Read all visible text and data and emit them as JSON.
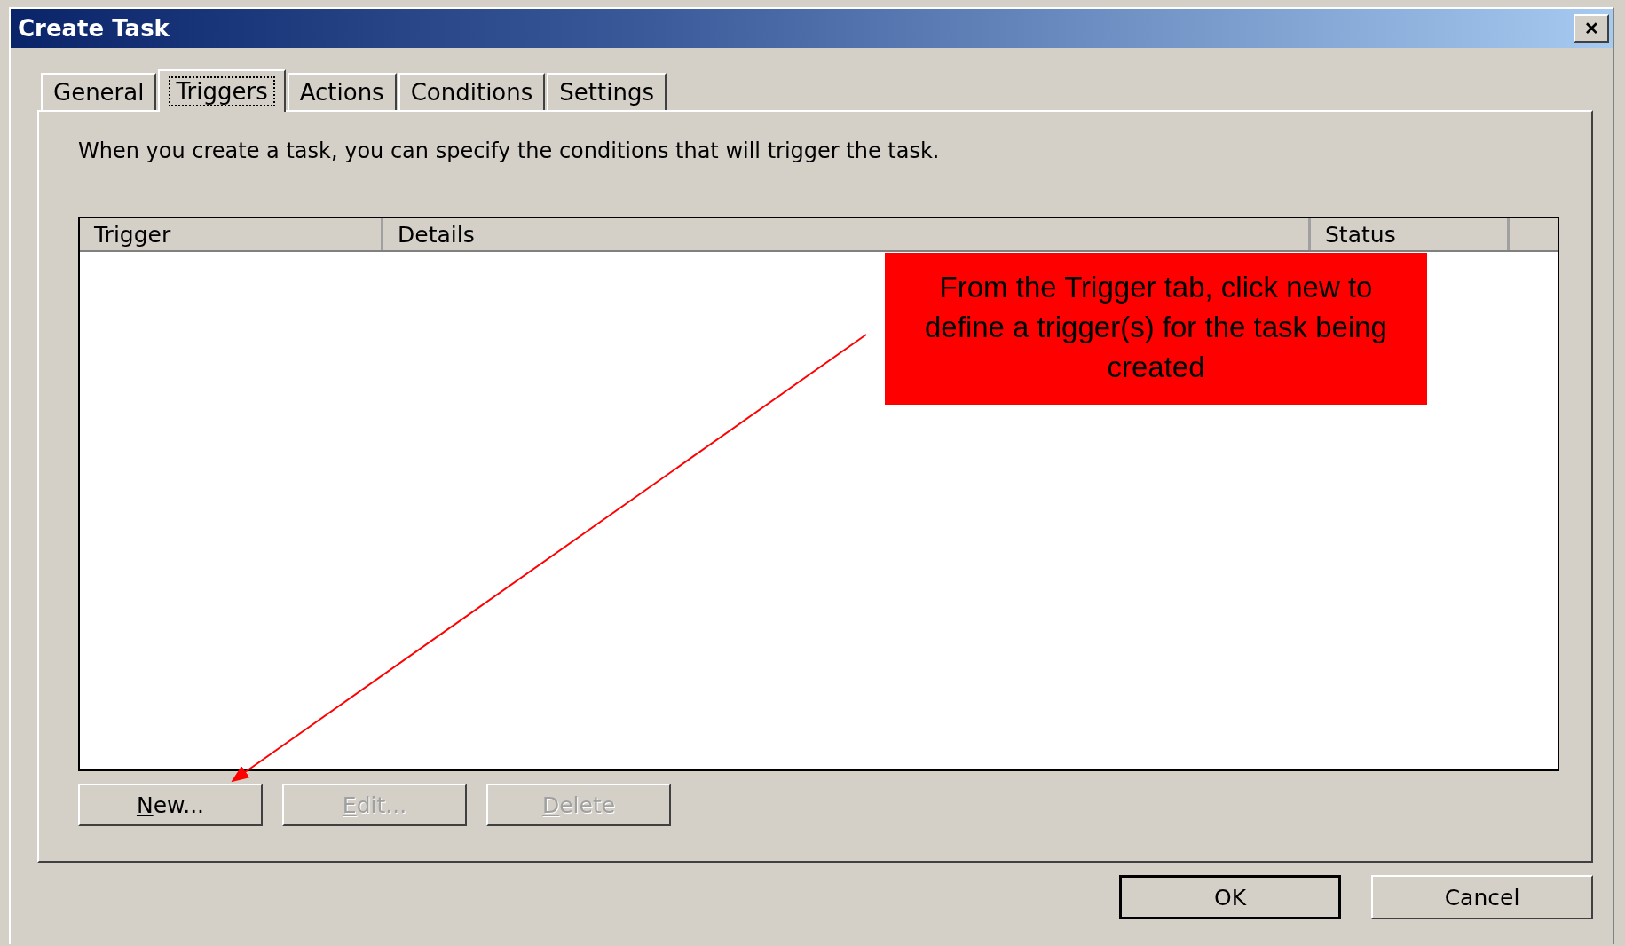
{
  "window": {
    "title": "Create Task",
    "close_label": "✕"
  },
  "tabs": [
    {
      "label": "General",
      "selected": false
    },
    {
      "label": "Triggers",
      "selected": true
    },
    {
      "label": "Actions",
      "selected": false
    },
    {
      "label": "Conditions",
      "selected": false
    },
    {
      "label": "Settings",
      "selected": false
    }
  ],
  "description": "When you create a task, you can specify the conditions that will trigger the task.",
  "table": {
    "columns": [
      "Trigger",
      "Details",
      "Status"
    ]
  },
  "buttons": [
    {
      "label": "New...",
      "disabled": false,
      "underline_first": true
    },
    {
      "label": "Edit...",
      "disabled": true,
      "underline_first": true
    },
    {
      "label": "Delete",
      "disabled": true,
      "underline_first": true
    }
  ],
  "dialog_buttons": [
    {
      "label": "OK",
      "default": true
    },
    {
      "label": "Cancel",
      "default": false
    }
  ],
  "callout": {
    "text": "From the Trigger tab, click new to define a trigger(s) for the task being created"
  }
}
